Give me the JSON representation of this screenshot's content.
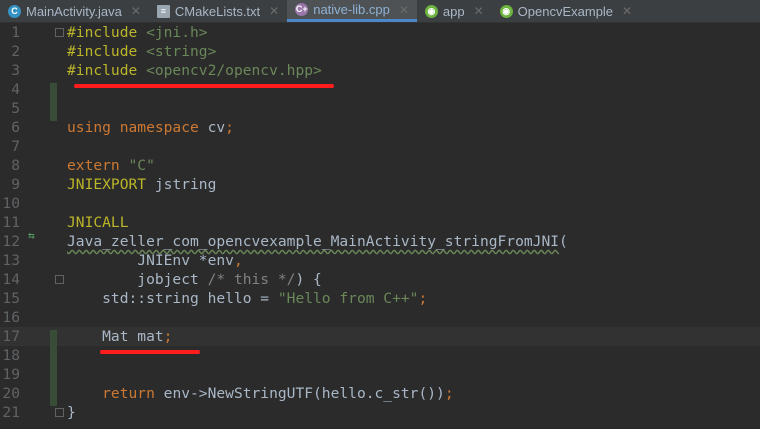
{
  "tabs": [
    {
      "label": "MainActivity.java",
      "icon": "java-class-icon",
      "active": false
    },
    {
      "label": "CMakeLists.txt",
      "icon": "text-file-icon",
      "active": false
    },
    {
      "label": "native-lib.cpp",
      "icon": "cpp-file-icon",
      "active": true
    },
    {
      "label": "app",
      "icon": "module-icon",
      "active": false
    },
    {
      "label": "OpencvExample",
      "icon": "module-icon",
      "active": false
    }
  ],
  "lines": [
    [
      [
        "pp",
        "#include "
      ],
      [
        "str",
        "<jni.h>"
      ]
    ],
    [
      [
        "pp",
        "#include "
      ],
      [
        "str",
        "<string>"
      ]
    ],
    [
      [
        "pp",
        "#include "
      ],
      [
        "str",
        "<opencv2/opencv.hpp>"
      ]
    ],
    [],
    [],
    [
      [
        "kw",
        "using namespace "
      ],
      [
        "",
        "cv"
      ],
      [
        "kw",
        ";"
      ]
    ],
    [],
    [
      [
        "kw",
        "extern "
      ],
      [
        "str",
        "\"C\""
      ]
    ],
    [
      [
        "pp",
        "JNIEXPORT "
      ],
      [
        "",
        "jstring"
      ]
    ],
    [],
    [
      [
        "pp",
        "JNICALL"
      ]
    ],
    [
      [
        "wavy",
        "Java_zeller_com_opencvexample_MainActivity_stringFromJNI"
      ],
      [
        "",
        "("
      ]
    ],
    [
      [
        "",
        "        JNIEnv *env"
      ],
      [
        "kw",
        ","
      ]
    ],
    [
      [
        "",
        "        jobject "
      ],
      [
        "cm",
        "/* this */"
      ],
      [
        "",
        ") {"
      ]
    ],
    [
      [
        "",
        "    std::string hello = "
      ],
      [
        "str",
        "\"Hello from C++\""
      ],
      [
        "kw",
        ";"
      ]
    ],
    [],
    [
      [
        "",
        "    Mat mat"
      ],
      [
        "kw",
        ";"
      ]
    ],
    [],
    [],
    [
      [
        "kw",
        "    return "
      ],
      [
        "",
        "env->NewStringUTF(hello.c_str())"
      ],
      [
        "kw",
        ";"
      ]
    ],
    [
      [
        "",
        "}"
      ]
    ]
  ]
}
